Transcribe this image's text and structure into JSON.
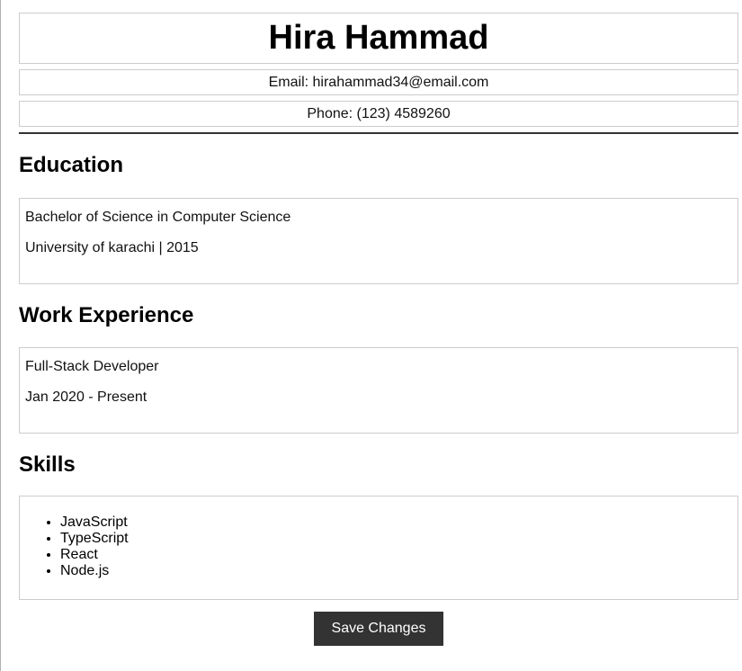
{
  "header": {
    "name": "Hira Hammad",
    "email": "Email: hirahammad34@email.com",
    "phone": "Phone: (123) 4589260"
  },
  "education": {
    "title": "Education",
    "degree": "Bachelor of Science in Computer Science",
    "school": "University of karachi | 2015"
  },
  "work": {
    "title": "Work Experience",
    "role": "Full-Stack Developer",
    "period": "Jan 2020 - Present"
  },
  "skills": {
    "title": "Skills",
    "items": [
      "JavaScript",
      "TypeScript",
      "React",
      "Node.js"
    ]
  },
  "actions": {
    "save_label": "Save Changes"
  },
  "colors": {
    "button_bg": "#333333",
    "button_text": "#ffffff",
    "border": "#cccccc",
    "divider": "#333333"
  }
}
